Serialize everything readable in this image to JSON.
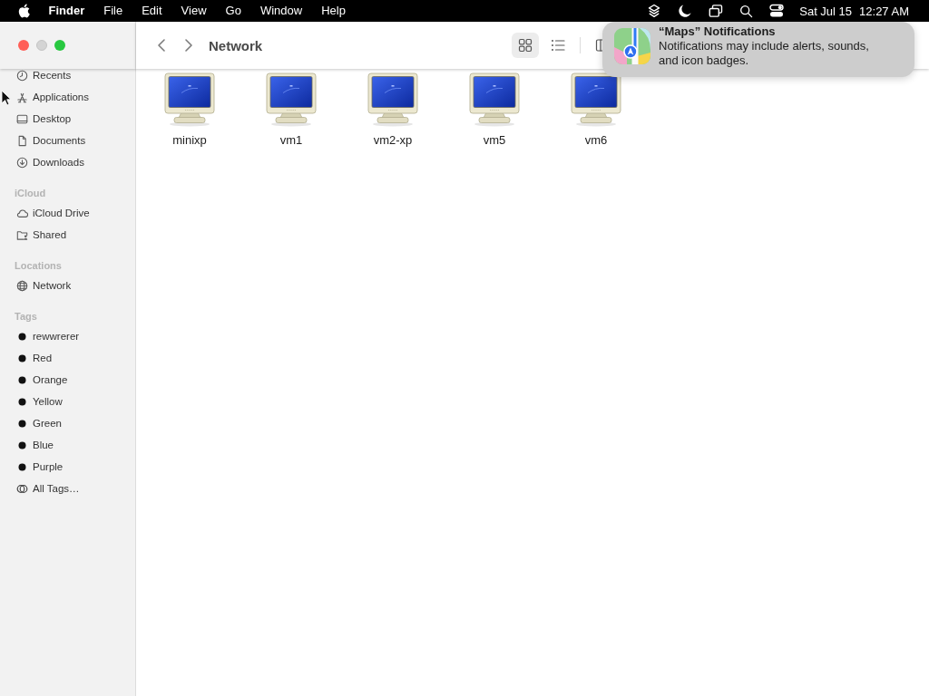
{
  "menu_bar": {
    "app_name": "Finder",
    "menus": [
      "File",
      "Edit",
      "View",
      "Go",
      "Window",
      "Help"
    ],
    "date": "Sat Jul 15",
    "time": "12:27 AM"
  },
  "window": {
    "title": "Network",
    "controls": [
      {
        "kind": "close",
        "disabled": false
      },
      {
        "kind": "minimize",
        "disabled": true
      },
      {
        "kind": "zoom",
        "disabled": false
      }
    ],
    "view_buttons": [
      {
        "kind": "icons",
        "selected": true
      },
      {
        "kind": "list",
        "selected": false
      },
      {
        "kind": "columns",
        "selected": false
      }
    ]
  },
  "sidebar": {
    "sections": [
      {
        "items": [
          {
            "label": "Recents",
            "kind": "place",
            "selected": false
          },
          {
            "label": "Applications",
            "kind": "place",
            "selected": false
          },
          {
            "label": "Desktop",
            "kind": "place",
            "selected": false
          },
          {
            "label": "Documents",
            "kind": "place",
            "selected": false
          },
          {
            "label": "Downloads",
            "kind": "place",
            "selected": false
          }
        ]
      },
      {
        "heading": "iCloud",
        "items": [
          {
            "label": "iCloud Drive",
            "kind": "place",
            "selected": false
          },
          {
            "label": "Shared",
            "kind": "place",
            "selected": false
          }
        ]
      },
      {
        "heading": "Locations",
        "items": [
          {
            "label": "Network",
            "kind": "place",
            "selected": false
          }
        ]
      },
      {
        "heading": "Tags",
        "items": [
          {
            "label": "rewwrerer",
            "kind": "tag",
            "selected": false
          },
          {
            "label": "Red",
            "kind": "tag",
            "selected": false
          },
          {
            "label": "Orange",
            "kind": "tag",
            "selected": false
          },
          {
            "label": "Yellow",
            "kind": "tag",
            "selected": false
          },
          {
            "label": "Green",
            "kind": "tag",
            "selected": false
          },
          {
            "label": "Blue",
            "kind": "tag",
            "selected": false
          },
          {
            "label": "Purple",
            "kind": "tag",
            "selected": false
          },
          {
            "label": "All Tags…",
            "kind": "all-tags",
            "selected": false
          }
        ]
      }
    ]
  },
  "files": [
    {
      "name": "minixp",
      "selected": false
    },
    {
      "name": "vm1",
      "selected": false
    },
    {
      "name": "vm2-xp",
      "selected": false
    },
    {
      "name": "vm5",
      "selected": false
    },
    {
      "name": "vm6",
      "selected": false
    }
  ],
  "notification": {
    "title": "“Maps” Notifications",
    "body": "Notifications may include alerts, sounds, and icon badges."
  }
}
